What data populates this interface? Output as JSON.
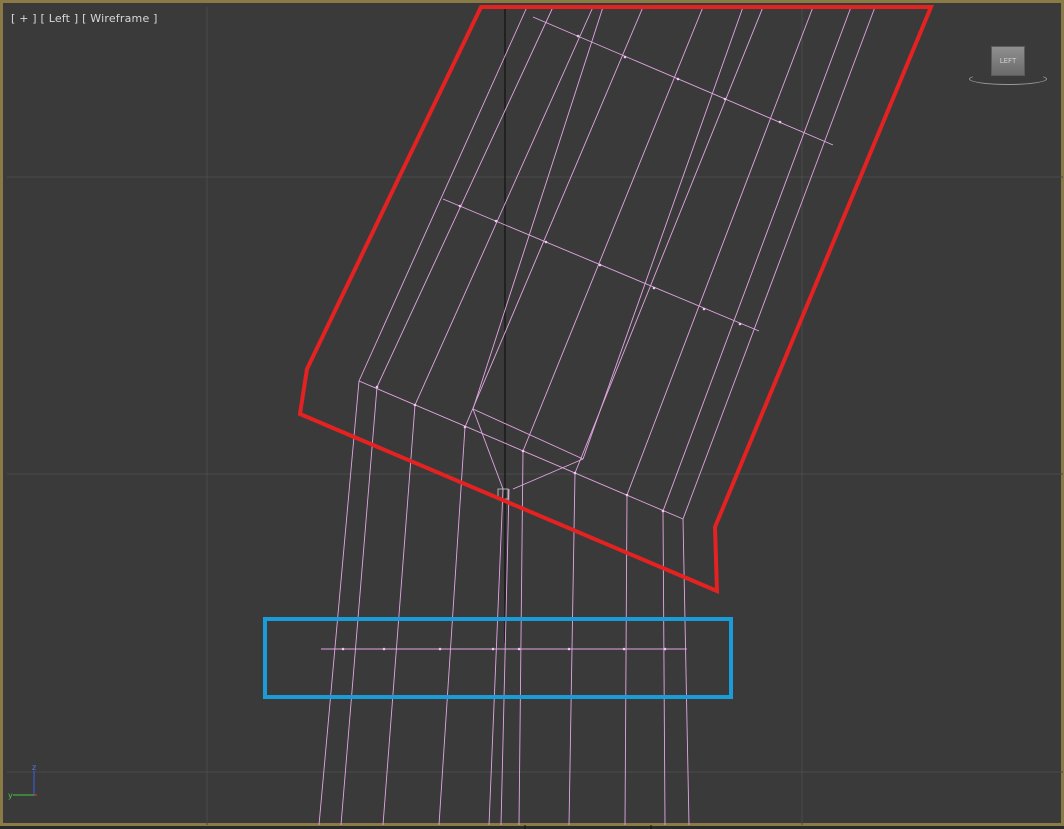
{
  "viewport": {
    "labels": [
      "[ + ]",
      "[ Left ]",
      "[ Wireframe ]"
    ],
    "viewcube_face": "LEFT",
    "gizmo_axes": {
      "z": "z",
      "y": "y",
      "x": "x"
    }
  },
  "colors": {
    "background": "#3a3a3a",
    "grid": "#4a4a4a",
    "wire": "#e6a8e6",
    "highlight_red": "#e52222",
    "highlight_blue": "#1a9cd8",
    "border": "#8a7a45"
  }
}
